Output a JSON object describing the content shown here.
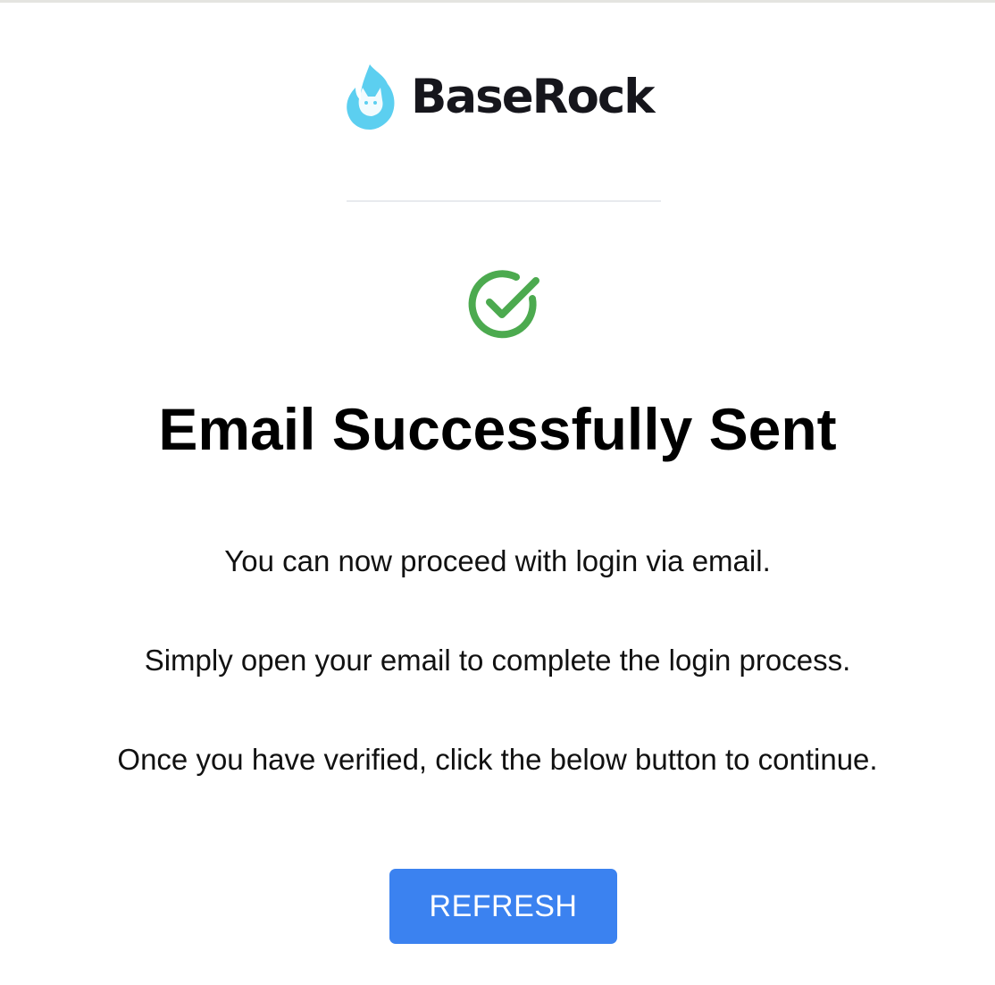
{
  "brand": {
    "name": "BaseRock",
    "logo_icon": "fox-flame-code-icon",
    "logo_color": "#5ccff0"
  },
  "status": {
    "icon": "check-circle-icon",
    "color": "#4caa4f"
  },
  "title": "Email Successfully Sent",
  "messages": [
    "You can now proceed with login via email.",
    "Simply open your email to complete the login process.",
    "Once you have verified, click the below button to continue."
  ],
  "actions": {
    "refresh_label": "REFRESH",
    "refresh_color": "#3b82f0"
  }
}
